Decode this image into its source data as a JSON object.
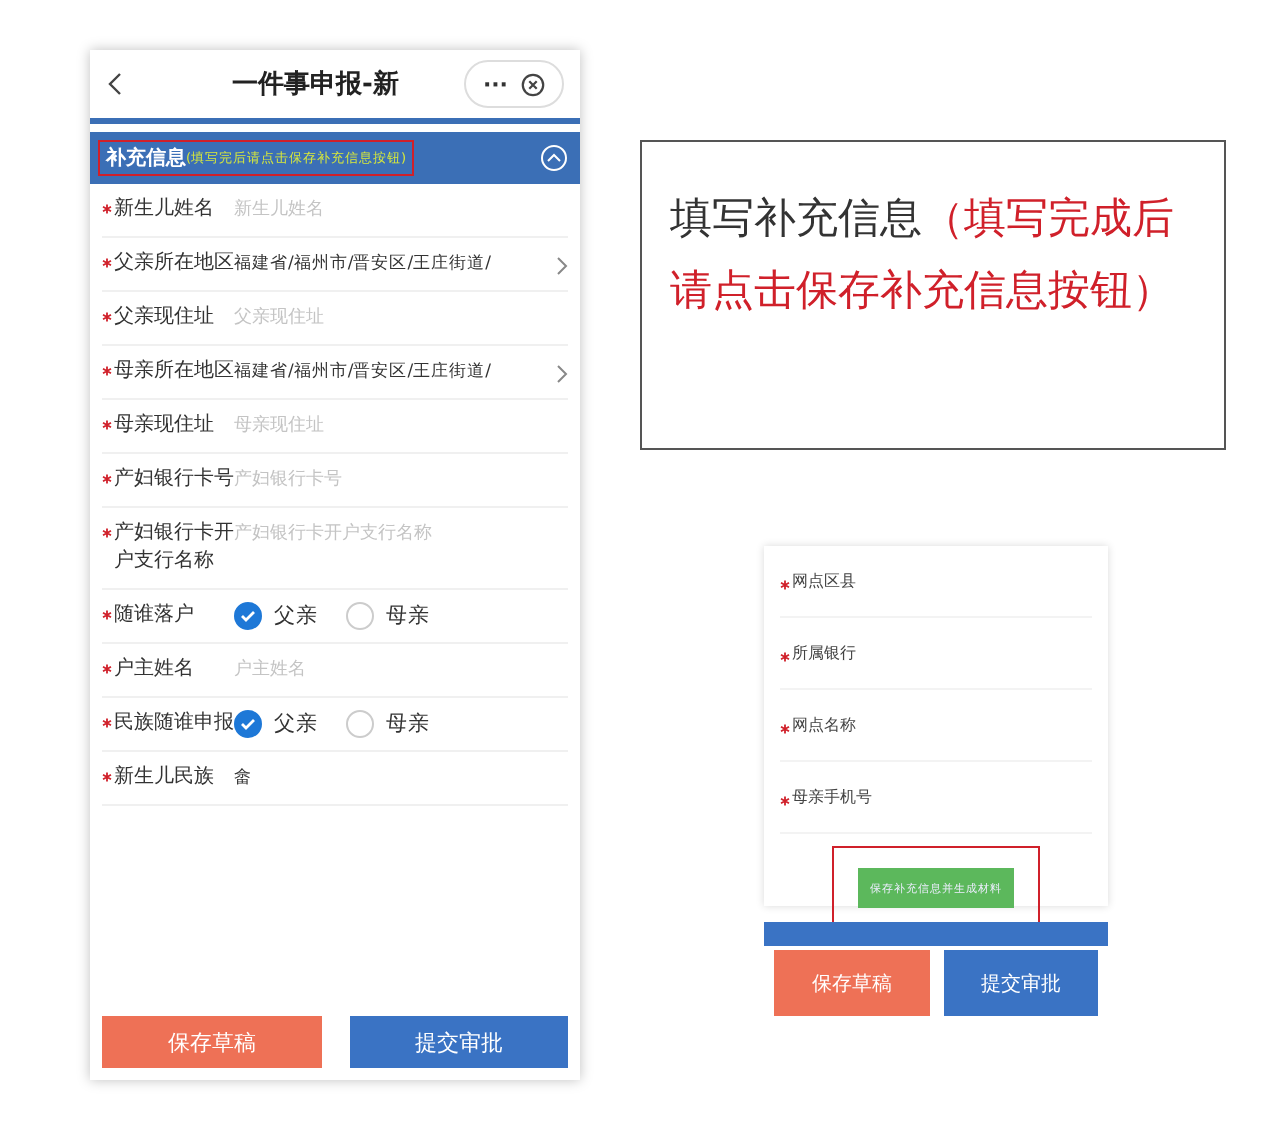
{
  "main_screen": {
    "title": "一件事申报-新",
    "more": "···",
    "section": {
      "title": "补充信息",
      "hint": "(填写完后请点击保存补充信息按钮)",
      "expanded": true
    },
    "fields": [
      {
        "kind": "input",
        "label": "新生儿姓名",
        "placeholder": "新生儿姓名"
      },
      {
        "kind": "select",
        "label": "父亲所在地区",
        "value": "福建省/福州市/晋安区/王庄街道/"
      },
      {
        "kind": "input",
        "label": "父亲现住址",
        "placeholder": "父亲现住址"
      },
      {
        "kind": "select",
        "label": "母亲所在地区",
        "value": "福建省/福州市/晋安区/王庄街道/"
      },
      {
        "kind": "input",
        "label": "母亲现住址",
        "placeholder": "母亲现住址"
      },
      {
        "kind": "input",
        "label": "产妇银行卡号",
        "placeholder": "产妇银行卡号"
      },
      {
        "kind": "input",
        "label": "产妇银行卡开户支行名称",
        "placeholder": "产妇银行卡开户支行名称"
      },
      {
        "kind": "radio",
        "label": "随谁落户",
        "options": [
          {
            "label": "父亲",
            "selected": true
          },
          {
            "label": "母亲",
            "selected": false
          }
        ]
      },
      {
        "kind": "input",
        "label": "户主姓名",
        "placeholder": "户主姓名"
      },
      {
        "kind": "radio",
        "label": "民族随谁申报",
        "options": [
          {
            "label": "父亲",
            "selected": true
          },
          {
            "label": "母亲",
            "selected": false
          }
        ]
      },
      {
        "kind": "text",
        "label": "新生儿民族",
        "value": "畲"
      }
    ],
    "buttons": [
      "保存草稿",
      "提交审批"
    ]
  },
  "annotation": {
    "text": "填写补充信息",
    "note": "（填写完成后请点击保存补充信息按钮）"
  },
  "detail_screen": {
    "fields": [
      "网点区县",
      "所属银行",
      "网点名称",
      "母亲手机号"
    ],
    "save_button": "保存补充信息并生成材料",
    "buttons": [
      "保存草稿",
      "提交审批"
    ]
  }
}
